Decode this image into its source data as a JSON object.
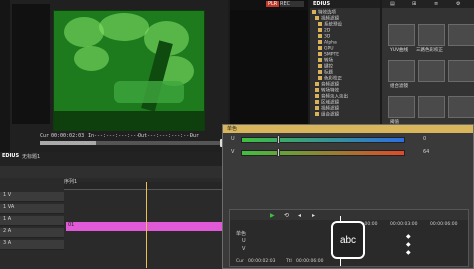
{
  "colors": {
    "accent": "#e8c050",
    "clip_pink": "#e05ad8",
    "slider_green": "#3fbf3f",
    "slider_blue": "#2f6fe0",
    "slider_red": "#e04a2a"
  },
  "player": {
    "plr_label": "PLR",
    "rec_label": "REC",
    "cur_label": "Cur",
    "cur_time": "00:00:02:03",
    "in_label": "In",
    "in_time": "---:---:---:---",
    "out_label": "Out",
    "out_time": "---:---:---:---",
    "dur_label": "Dur",
    "dur_time": "---:---:---:---"
  },
  "app": {
    "brand": "EDIUS",
    "project_label": "无标题1"
  },
  "tree": {
    "items": [
      "特效选项",
      "视频滤镜",
      "系统预设",
      "2D",
      "3D",
      "Alpha",
      "GPU",
      "SMPTE",
      "转场",
      "键控",
      "标题",
      "色彩校正",
      "音频滤镜",
      "转场特效",
      "音频淡入淡出",
      "区域滤镜",
      "视频滤镜",
      "组合滤镜"
    ]
  },
  "fx": {
    "cells": [
      "YUV曲线",
      "三路色彩校正",
      "",
      "组合滤镜",
      "",
      "",
      "阈值",
      "",
      ""
    ]
  },
  "dialog": {
    "title": "单色",
    "u_label": "U",
    "u_value": "0",
    "v_label": "V",
    "v_value": "64",
    "tracks": [
      "单色",
      "U",
      "V"
    ],
    "time_start": "00:00:00:00",
    "time_mid": "00:00:03:00",
    "time_end": "00:00:06:00",
    "cur_label": "Cur",
    "cur_time": "00:00:02:03",
    "ttl_label": "Ttl",
    "ttl_time": "00:00:06:00",
    "abc_label": "abc",
    "sliders": [
      {
        "name": "U",
        "level": 0.22
      },
      {
        "name": "V",
        "level": 0.22
      }
    ]
  },
  "timeline": {
    "seq_label": "序列1",
    "tracks": [
      "1 V",
      "1 VA",
      "1 A",
      "2 A",
      "3 A"
    ],
    "clip_label": "01"
  }
}
